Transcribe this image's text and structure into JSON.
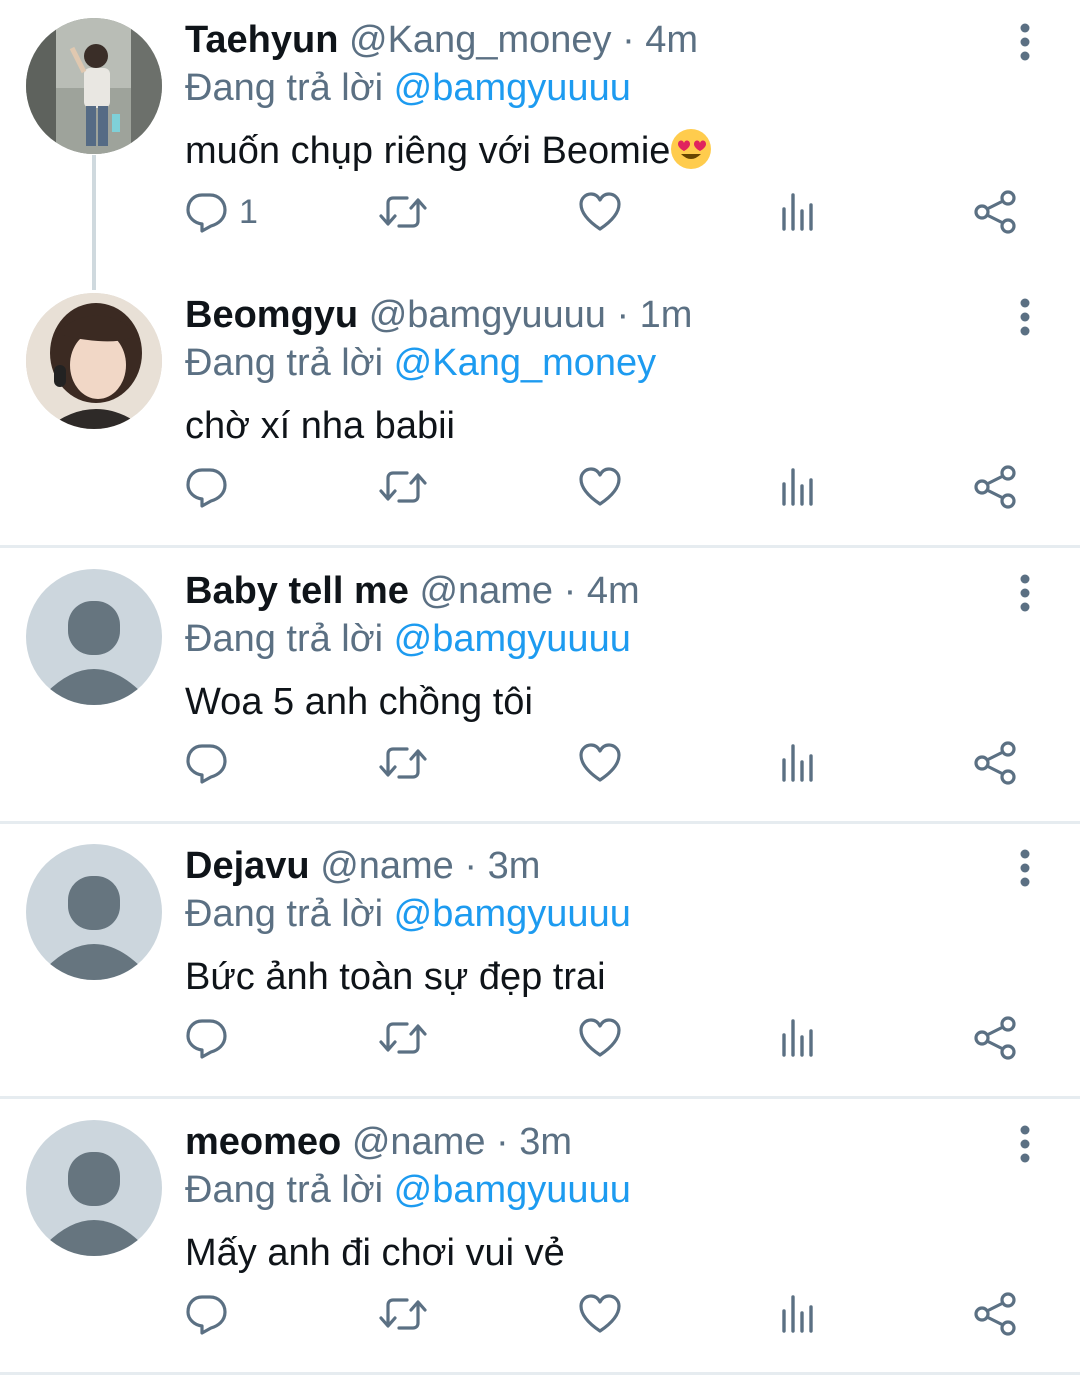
{
  "colors": {
    "mention": "#1d9bf0",
    "secondary_text": "#5b7083",
    "primary_text": "#0f1419",
    "divider": "#e6ecf0",
    "default_avatar_bg": "#ccd6dd",
    "default_avatar_fg": "#66757f"
  },
  "tweets": [
    {
      "name": "Taehyun",
      "handle": "@Kang_money",
      "sep": "·",
      "time": "4m",
      "reply_prefix": "Đang trả lời",
      "reply_to": "@bamgyuuuu",
      "text": "muốn chụp riêng với Beomie",
      "emoji": "smiling-face-with-heart-eyes",
      "reply_count": "1",
      "avatar": "photo"
    },
    {
      "name": "Beomgyu",
      "handle": "@bamgyuuuu",
      "sep": "·",
      "time": "1m",
      "reply_prefix": "Đang trả lời",
      "reply_to": "@Kang_money",
      "text": "chờ xí nha babii",
      "reply_count": "",
      "avatar": "photo"
    },
    {
      "name": "Baby tell me",
      "handle": "@name",
      "sep": "·",
      "time": "4m",
      "reply_prefix": "Đang trả lời",
      "reply_to": "@bamgyuuuu",
      "text": "Woa 5 anh chồng tôi",
      "reply_count": "",
      "avatar": "default"
    },
    {
      "name": "Dejavu",
      "handle": "@name",
      "sep": "·",
      "time": "3m",
      "reply_prefix": "Đang trả lời",
      "reply_to": "@bamgyuuuu",
      "text": "Bức ảnh toàn sự đẹp trai",
      "reply_count": "",
      "avatar": "default"
    },
    {
      "name": "meomeo",
      "handle": "@name",
      "sep": "·",
      "time": "3m",
      "reply_prefix": "Đang trả lời",
      "reply_to": "@bamgyuuuu",
      "text": "Mấy anh đi chơi vui vẻ",
      "reply_count": "",
      "avatar": "default"
    }
  ],
  "icons": {
    "reply": "reply-icon",
    "retweet": "retweet-icon",
    "like": "heart-icon",
    "stats": "analytics-icon",
    "share": "share-icon",
    "more": "more-vertical-icon"
  }
}
